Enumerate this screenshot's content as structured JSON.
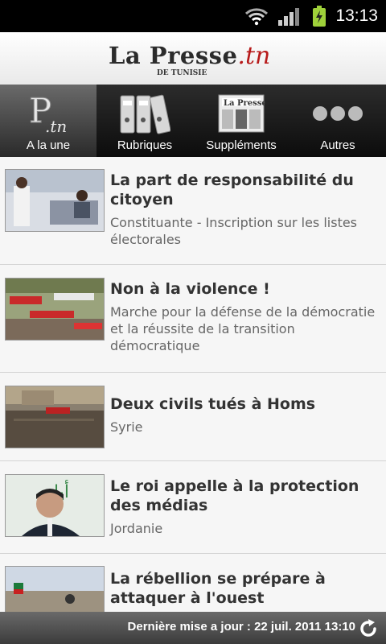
{
  "status": {
    "time": "13:13"
  },
  "header": {
    "logo_main": "La Presse",
    "logo_tn": ".tn",
    "logo_sub": "DE TUNISIE"
  },
  "tabs": [
    {
      "label": "A la une",
      "icon": "ptn-logo-icon",
      "active": true
    },
    {
      "label": "Rubriques",
      "icon": "binders-icon"
    },
    {
      "label": "Suppléments",
      "icon": "newspaper-icon"
    },
    {
      "label": "Autres",
      "icon": "more-dots-icon"
    }
  ],
  "articles": [
    {
      "title": "La part de responsabilité du citoyen",
      "subtitle": "Constituante - Inscription sur les listes électorales"
    },
    {
      "title": "Non à la violence !",
      "subtitle": "Marche pour la défense de la démocratie et la réussite de la transition démocratique"
    },
    {
      "title": "Deux civils tués à Homs",
      "subtitle": "Syrie"
    },
    {
      "title": "Le roi appelle à la protection des médias",
      "subtitle": "Jordanie"
    },
    {
      "title": "La rébellion se prépare à attaquer à l'ouest",
      "subtitle": ""
    }
  ],
  "footer": {
    "last_update": "Dernière mise a jour : 22 juil. 2011 13:10"
  },
  "colors": {
    "tn_red": "#b71a1a",
    "tab_bg": "#111111"
  }
}
